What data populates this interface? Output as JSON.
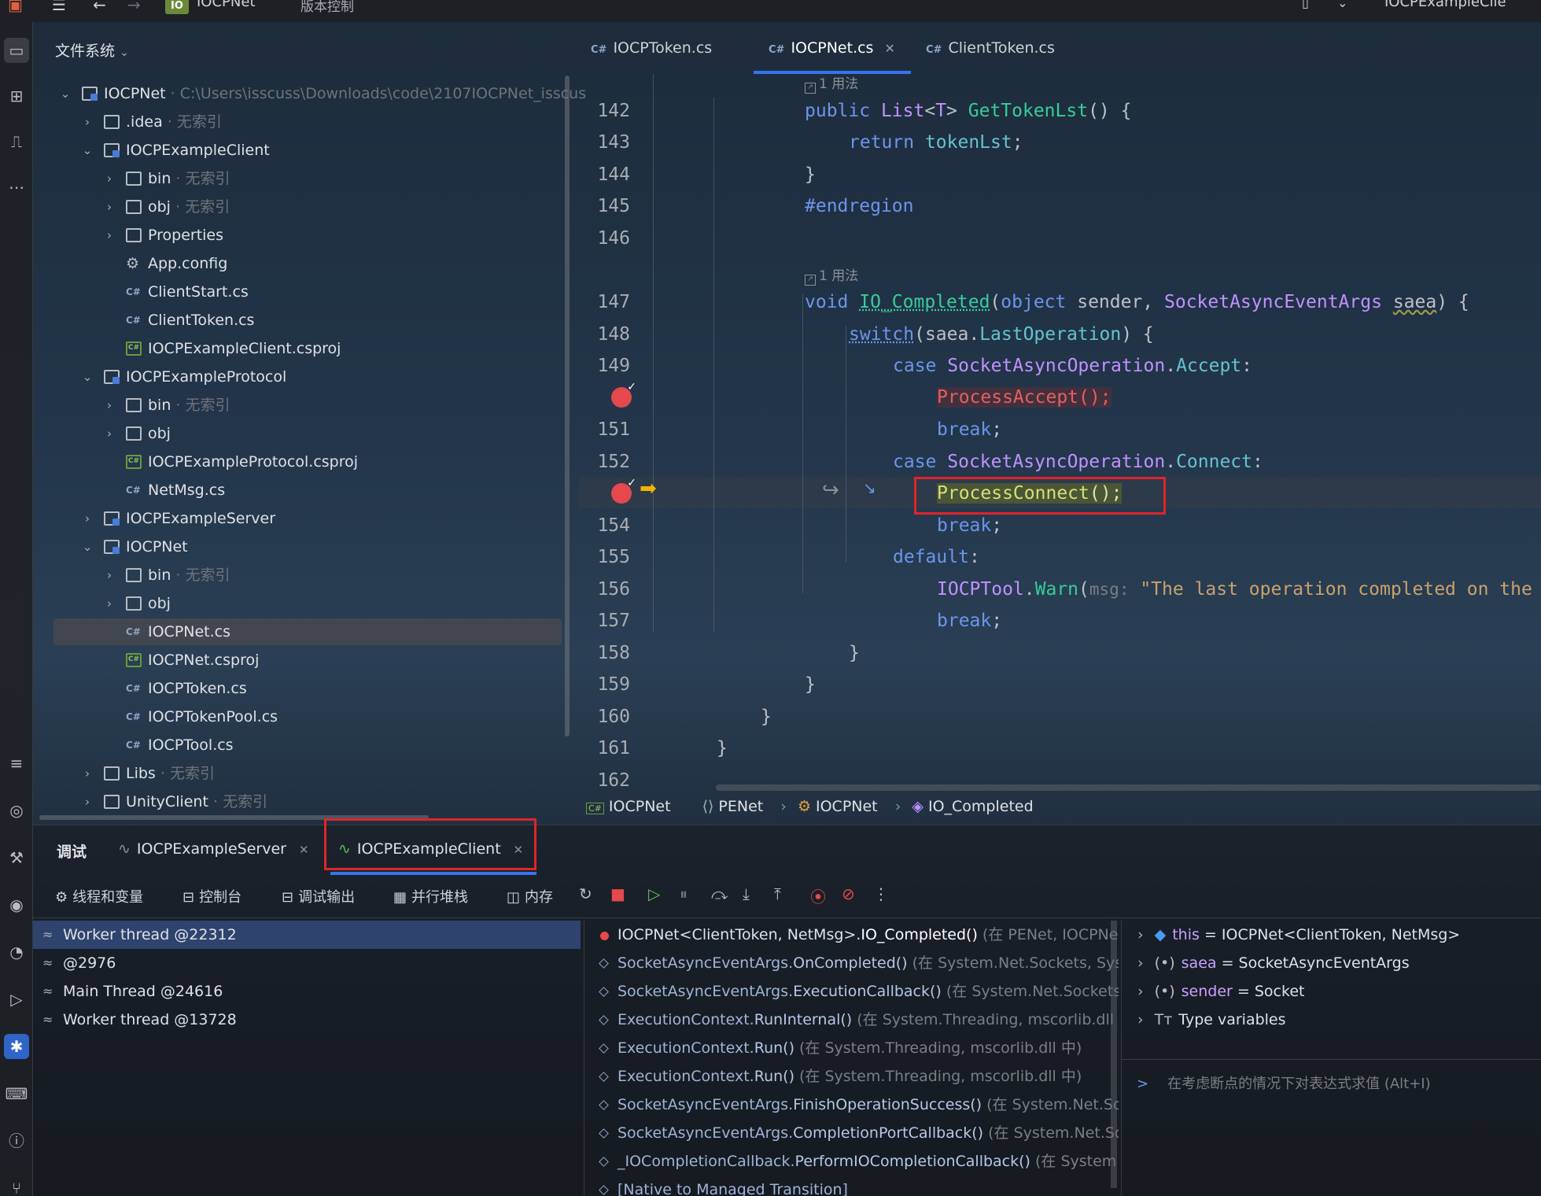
{
  "topbar": {
    "project_badge": "IO",
    "project_name": "IOCPNet",
    "vcs_menu": "版本控制",
    "run_config": "IOCPExampleClie"
  },
  "tree": {
    "title": "文件系统",
    "rows": [
      {
        "label": "IOCPNet",
        "extra": "C:\\Users\\isscuss\\Downloads\\code\\2107IOCPNet_isscus"
      },
      {
        "label": ".idea",
        "extra": "无索引"
      },
      {
        "label": "IOCPExampleClient",
        "extra": ""
      },
      {
        "label": "bin",
        "extra": "无索引"
      },
      {
        "label": "obj",
        "extra": "无索引"
      },
      {
        "label": "Properties",
        "extra": ""
      },
      {
        "label": "App.config",
        "extra": ""
      },
      {
        "label": "ClientStart.cs",
        "extra": ""
      },
      {
        "label": "ClientToken.cs",
        "extra": ""
      },
      {
        "label": "IOCPExampleClient.csproj",
        "extra": ""
      },
      {
        "label": "IOCPExampleProtocol",
        "extra": ""
      },
      {
        "label": "bin",
        "extra": "无索引"
      },
      {
        "label": "obj",
        "extra": ""
      },
      {
        "label": "IOCPExampleProtocol.csproj",
        "extra": ""
      },
      {
        "label": "NetMsg.cs",
        "extra": ""
      },
      {
        "label": "IOCPExampleServer",
        "extra": ""
      },
      {
        "label": "IOCPNet",
        "extra": ""
      },
      {
        "label": "bin",
        "extra": "无索引"
      },
      {
        "label": "obj",
        "extra": ""
      },
      {
        "label": "IOCPNet.cs",
        "extra": ""
      },
      {
        "label": "IOCPNet.csproj",
        "extra": ""
      },
      {
        "label": "IOCPToken.cs",
        "extra": ""
      },
      {
        "label": "IOCPTokenPool.cs",
        "extra": ""
      },
      {
        "label": "IOCPTool.cs",
        "extra": ""
      },
      {
        "label": "Libs",
        "extra": "无索引"
      },
      {
        "label": "UnityClient",
        "extra": "无索引"
      }
    ]
  },
  "editor": {
    "tabs": [
      "IOCPToken.cs",
      "IOCPNet.cs",
      "ClientToken.cs"
    ],
    "cs_tag": "C#",
    "usage_hint": "1 用法",
    "line_numbers": [
      "142",
      "143",
      "144",
      "145",
      "146",
      "147",
      "148",
      "149",
      "151",
      "152",
      "154",
      "155",
      "156",
      "157",
      "158",
      "159",
      "160",
      "161",
      "162"
    ],
    "code": {
      "l142": {
        "kw": "public ",
        "ty": "List",
        "p1": "<",
        "ty2": "T",
        "p2": "> ",
        "fn": "GetTokenLst",
        "p3": "() {"
      },
      "l143": {
        "kw": "return ",
        "fld": "tokenLst",
        "p": ";"
      },
      "l144": "}",
      "l145": "#endregion",
      "l147": {
        "kw": "void ",
        "fn": "IO_Completed",
        "p1": "(",
        "kw2": "object",
        "p2": " sender, ",
        "ty": "SocketAsyncEventArgs",
        "p3": " ",
        "pn": "saea",
        "p4": ") {"
      },
      "l148": {
        "fn": "switch",
        "p1": "(saea.",
        "fld": "LastOperation",
        "p2": ") {"
      },
      "l149": {
        "kw": "case ",
        "ty": "SocketAsyncOperation",
        "p1": ".",
        "fld": "Accept",
        "p2": ":"
      },
      "l150": {
        "fn": "ProcessAccept",
        "p": "();"
      },
      "l151": {
        "kw": "break",
        "p": ";"
      },
      "l152": {
        "kw": "case ",
        "ty": "SocketAsyncOperation",
        "p1": ".",
        "fld": "Connect",
        "p2": ":"
      },
      "l153": {
        "fn": "ProcessConnect",
        "p": "();"
      },
      "l154": {
        "kw": "break",
        "p": ";"
      },
      "l155": {
        "kw": "default",
        "p": ":"
      },
      "l156": {
        "ty": "IOCPTool",
        "p1": ".",
        "fn": "Warn",
        "p2": "(",
        "hint": "msg:",
        "str": "\"The last operation completed on the"
      },
      "l157": {
        "kw": "break",
        "p": ";"
      },
      "l158": "}",
      "l159": "}",
      "l160": "}",
      "l161": "}"
    },
    "breadcrumb": [
      "IOCPNet",
      "PENet",
      "IOCPNet",
      "IO_Completed"
    ]
  },
  "debug": {
    "tab_debug": "调试",
    "session_tabs": [
      "IOCPExampleServer",
      "IOCPExampleClient"
    ],
    "toolbar": [
      "线程和变量",
      "控制台",
      "调试输出",
      "并行堆栈",
      "内存"
    ],
    "threads": [
      "Worker thread @22312",
      "@2976",
      "Main Thread @24616",
      "Worker thread @13728"
    ],
    "frames": [
      {
        "pre": "IOCPNet<ClientToken, NetMsg>.",
        "method": "IO_Completed()",
        "loc": " (在 PENet, IOCPNet"
      },
      {
        "pre": "SocketAsyncEventArgs.",
        "method": "OnCompleted()",
        "loc": " (在 System.Net.Sockets, Syst"
      },
      {
        "pre": "SocketAsyncEventArgs.",
        "method": "ExecutionCallback()",
        "loc": " (在 System.Net.Sockets"
      },
      {
        "pre": "ExecutionContext.",
        "method": "RunInternal()",
        "loc": " (在 System.Threading, mscorlib.dll 中"
      },
      {
        "pre": "ExecutionContext.",
        "method": "Run()",
        "loc": " (在 System.Threading, mscorlib.dll 中)"
      },
      {
        "pre": "ExecutionContext.",
        "method": "Run()",
        "loc": " (在 System.Threading, mscorlib.dll 中)"
      },
      {
        "pre": "SocketAsyncEventArgs.",
        "method": "FinishOperationSuccess()",
        "loc": " (在 System.Net.So"
      },
      {
        "pre": "SocketAsyncEventArgs.",
        "method": "CompletionPortCallback()",
        "loc": " (在 System.Net.So"
      },
      {
        "pre": "_IOCompletionCallback.",
        "method": "PerformIOCompletionCallback()",
        "loc": " (在 System"
      },
      {
        "pre": "[Native to Managed Transition]",
        "method": "",
        "loc": ""
      }
    ],
    "variables": [
      {
        "name": "this",
        "value": " = IOCPNet<ClientToken, NetMsg>"
      },
      {
        "name": "saea",
        "value": " = SocketAsyncEventArgs"
      },
      {
        "name": "sender",
        "value": " = Socket"
      },
      {
        "name": "Type variables",
        "value": ""
      }
    ],
    "eval_placeholder": "在考虑断点的情况下对表达式求值 (Alt+I)"
  }
}
